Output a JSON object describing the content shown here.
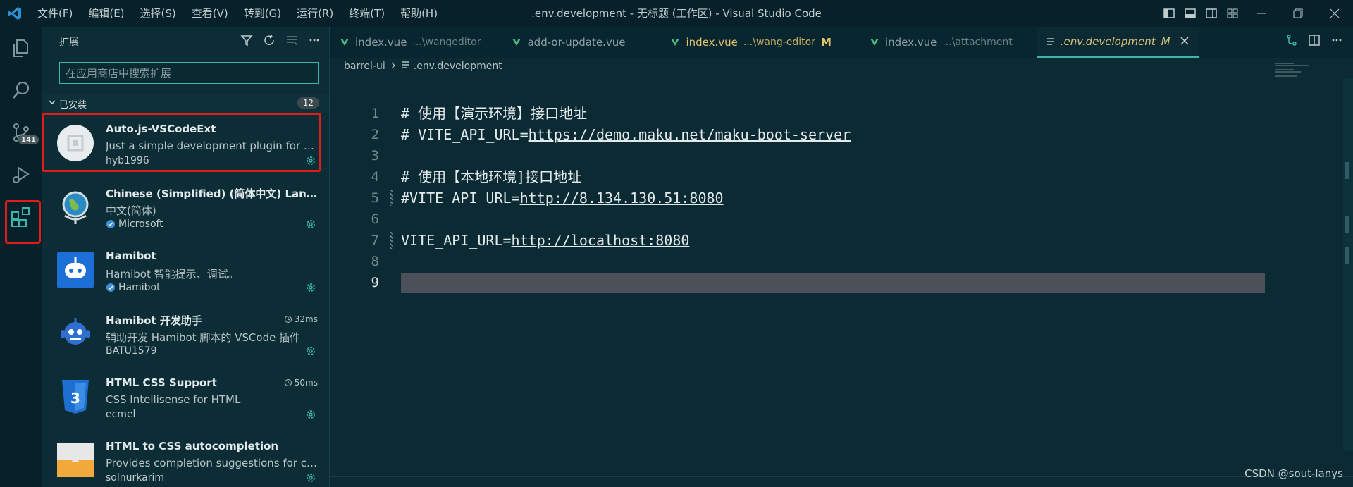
{
  "titlebar": {
    "title": ".env.development - 无标题 (工作区) - Visual Studio Code",
    "menu": [
      "文件(F)",
      "编辑(E)",
      "选择(S)",
      "查看(V)",
      "转到(G)",
      "运行(R)",
      "终端(T)",
      "帮助(H)"
    ]
  },
  "activity": {
    "scm_badge": "141"
  },
  "sidebar": {
    "title": "扩展",
    "search_placeholder": "在应用商店中搜索扩展",
    "section_label": "已安装",
    "section_count": "12",
    "extensions": [
      {
        "name": "Auto.js-VSCodeExt",
        "desc": "Just a simple development plugin for An...",
        "publisher": "hyb1996",
        "verified": false,
        "time": ""
      },
      {
        "name": "Chinese (Simplified) (简体中文) Langu...",
        "desc": "中文(简体)",
        "publisher": "Microsoft",
        "verified": true,
        "time": ""
      },
      {
        "name": "Hamibot",
        "desc": "Hamibot 智能提示、调试。",
        "publisher": "Hamibot",
        "verified": true,
        "time": ""
      },
      {
        "name": "Hamibot 开发助手",
        "desc": "辅助开发 Hamibot 脚本的 VSCode 插件",
        "publisher": "BATU1579",
        "verified": false,
        "time": "32ms"
      },
      {
        "name": "HTML CSS Support",
        "desc": "CSS Intellisense for HTML",
        "publisher": "ecmel",
        "verified": false,
        "time": "50ms"
      },
      {
        "name": "HTML to CSS autocompletion",
        "desc": "Provides completion suggestions for cla...",
        "publisher": "solnurkarim",
        "verified": false,
        "time": ""
      }
    ]
  },
  "editor": {
    "tabs": [
      {
        "label": "index.vue",
        "path": "...\\wangeditor",
        "status": ""
      },
      {
        "label": "add-or-update.vue",
        "path": "",
        "status": ""
      },
      {
        "label": "index.vue",
        "path": "...\\wang-editor",
        "status": "M"
      },
      {
        "label": "index.vue",
        "path": "...\\attachment",
        "status": ""
      },
      {
        "label": ".env.development",
        "path": "",
        "status": "M"
      }
    ],
    "breadcrumb": [
      "barrel-ui",
      ".env.development"
    ],
    "lines": [
      {
        "n": "1",
        "pre": "# 使用【演示环境】接口地址",
        "url": ""
      },
      {
        "n": "2",
        "pre": "# VITE_API_URL=",
        "url": "https://demo.maku.net/maku-boot-server"
      },
      {
        "n": "3",
        "pre": "",
        "url": ""
      },
      {
        "n": "4",
        "pre": "# 使用【本地环境]接口地址",
        "url": ""
      },
      {
        "n": "5",
        "pre": "#VITE_API_URL=",
        "url": "http://8.134.130.51:8080"
      },
      {
        "n": "6",
        "pre": "",
        "url": ""
      },
      {
        "n": "7",
        "pre": "VITE_API_URL=",
        "url": "http://localhost:8080"
      },
      {
        "n": "8",
        "pre": "",
        "url": ""
      },
      {
        "n": "9",
        "pre": "",
        "url": ""
      }
    ]
  },
  "watermark": "CSDN @sout-lanys",
  "colors": {
    "accent": "#3fb4a8",
    "highlight_box": "#e21b1b",
    "modified": "#e2c26a"
  }
}
